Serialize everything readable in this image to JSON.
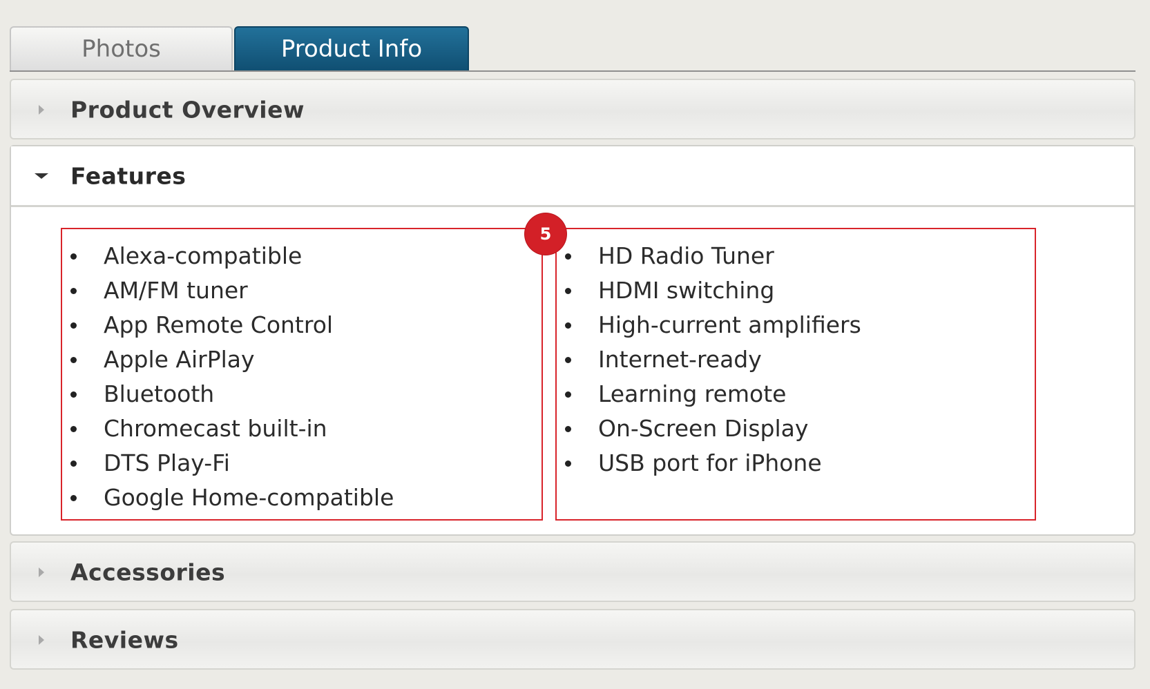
{
  "tabs": {
    "photos_label": "Photos",
    "product_info_label": "Product Info"
  },
  "sections": {
    "overview_title": "Product Overview",
    "features_title": "Features",
    "accessories_title": "Accessories",
    "reviews_title": "Reviews"
  },
  "badge": "5",
  "features": {
    "left": [
      "Alexa-compatible",
      "AM/FM tuner",
      "App Remote Control",
      "Apple AirPlay",
      "Bluetooth",
      "Chromecast built-in",
      "DTS Play-Fi",
      "Google Home-compatible"
    ],
    "right": [
      "HD Radio Tuner",
      "HDMI switching",
      "High-current amplifiers",
      "Internet-ready",
      "Learning remote",
      "On-Screen Display",
      "USB port for iPhone"
    ]
  },
  "colors": {
    "active_tab": "#1b6289",
    "highlight_border": "#d8232a",
    "badge": "#d32027"
  }
}
